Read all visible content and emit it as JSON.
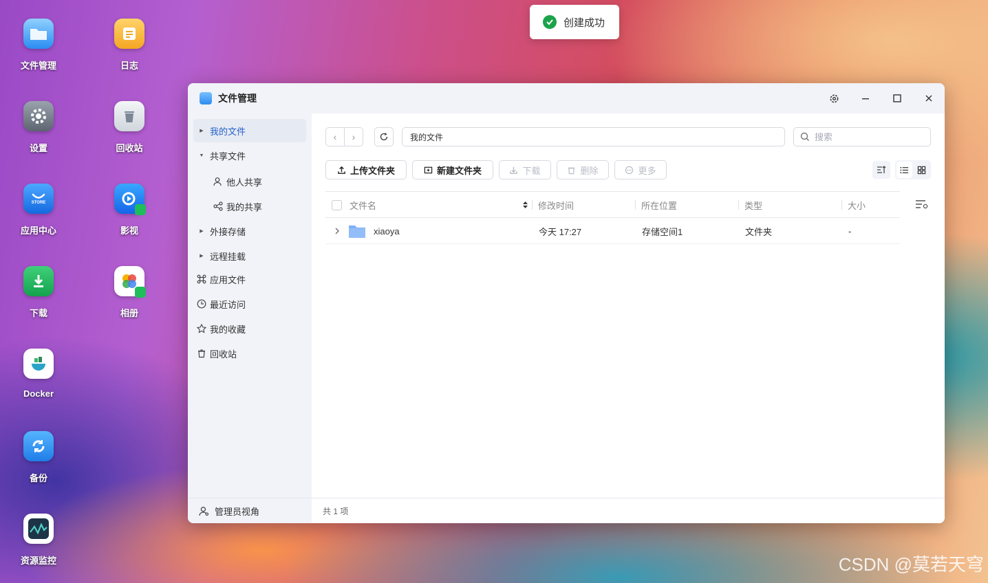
{
  "desktop": {
    "icons": [
      {
        "label": "文件管理"
      },
      {
        "label": "日志"
      },
      {
        "label": "设置"
      },
      {
        "label": "回收站"
      },
      {
        "label": "应用中心",
        "badge": "STORE"
      },
      {
        "label": "影视"
      },
      {
        "label": "下载"
      },
      {
        "label": "相册"
      },
      {
        "label": "Docker"
      },
      {
        "label": "备份"
      },
      {
        "label": "资源监控"
      }
    ]
  },
  "toast": {
    "message": "创建成功"
  },
  "window": {
    "title": "文件管理",
    "sidebar": {
      "items": [
        {
          "label": "我的文件"
        },
        {
          "label": "共享文件"
        },
        {
          "label": "他人共享"
        },
        {
          "label": "我的共享"
        },
        {
          "label": "外接存储"
        },
        {
          "label": "远程挂载"
        },
        {
          "label": "应用文件"
        },
        {
          "label": "最近访问"
        },
        {
          "label": "我的收藏"
        },
        {
          "label": "回收站"
        }
      ],
      "footer": "管理员视角"
    },
    "path": "我的文件",
    "search_placeholder": "搜索",
    "toolbar": {
      "upload_folder": "上传文件夹",
      "new_folder": "新建文件夹",
      "download": "下载",
      "delete": "删除",
      "more": "更多"
    },
    "table": {
      "columns": [
        "文件名",
        "修改时间",
        "所在位置",
        "类型",
        "大小"
      ],
      "rows": [
        {
          "name": "xiaoya",
          "modified": "今天 17:27",
          "location": "存储空间1",
          "type": "文件夹",
          "size": "-"
        }
      ]
    },
    "status": "共 1 项"
  },
  "watermark": "CSDN @莫若天穹",
  "colors": {
    "accent": "#2563c9",
    "success": "#1aa34a",
    "folder": "#7fb0f5"
  }
}
